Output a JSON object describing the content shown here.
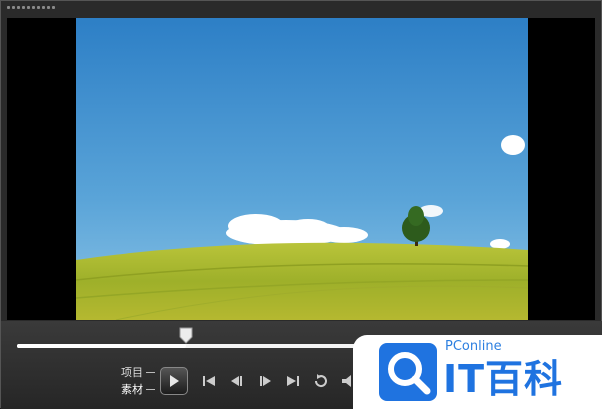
{
  "player": {
    "source_label": "项目",
    "clip_label": "素材"
  },
  "playback": {
    "progress": 0.49
  },
  "watermark": {
    "brand": "PConline",
    "name": "IT百科"
  },
  "icons": {
    "play": "play-icon",
    "start": "go-to-start-icon",
    "prev_frame": "previous-frame-icon",
    "next_frame": "next-frame-icon",
    "end": "go-to-end-icon",
    "repeat": "repeat-icon",
    "volume": "volume-icon"
  },
  "colors": {
    "accent": "#1f73e0",
    "track": "#f4f4f4"
  }
}
